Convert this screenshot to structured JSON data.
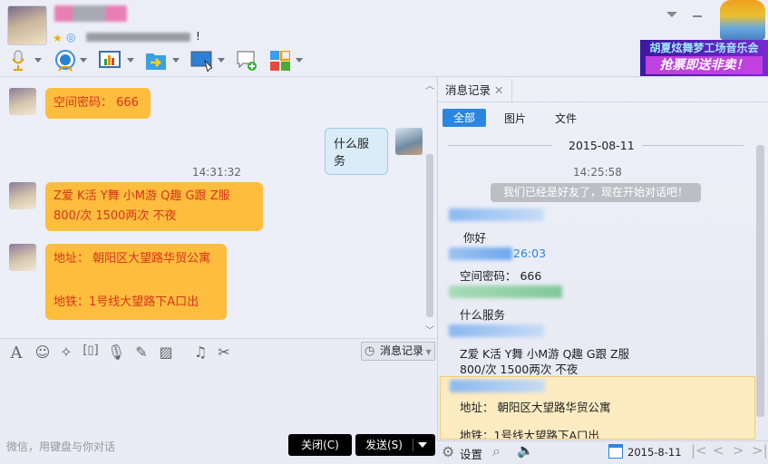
{
  "header": {
    "status_suffix": "!",
    "banner": {
      "line1": "胡夏炫舞梦工场音乐会",
      "line2": "抢票即送非卖！"
    }
  },
  "toolbar": {
    "icons": [
      "microphone-icon",
      "webcam-icon",
      "screen-share-icon",
      "file-transfer-icon",
      "remote-desktop-icon",
      "new-chat-icon",
      "apps-icon"
    ]
  },
  "chat": {
    "messages": [
      {
        "side": "left",
        "text": "空间密码： 666"
      },
      {
        "side": "right",
        "text": "什么服务"
      },
      {
        "timestamp": "14:31:32"
      },
      {
        "side": "left",
        "lines": [
          "Z爱  K活  Y舞  小M游  Q趣  G跟  Z服",
          "800/次   1500两次     不夜"
        ]
      },
      {
        "side": "left",
        "lines": [
          "地址：  朝阳区大望路华贸公寓",
          "",
          "地铁：1号线大望路下A口出"
        ]
      }
    ]
  },
  "input": {
    "history_button": "消息记录",
    "placeholder": "微信，用键盘与你对话",
    "close_button": "关闭(C)",
    "send_button": "发送(S)"
  },
  "history": {
    "tab_label": "消息记录",
    "filters": [
      "全部",
      "图片",
      "文件"
    ],
    "date": "2015-08-11",
    "time": "14:25:58",
    "system_notice": "我们已经是好友了，现在开始对话吧！",
    "entries": [
      {
        "text": "你好"
      },
      {
        "time_fragment": "26:03",
        "text": "空间密码： 666"
      },
      {
        "text": "什么服务"
      },
      {
        "lines": [
          "Z爱   K活   Y舞   小M游   Q趣   G跟   Z服",
          "800/次   1500两次     不夜"
        ]
      },
      {
        "lines": [
          "地址：  朝阳区大望路华贸公寓",
          "",
          "地铁：1号线大望路下A口出"
        ]
      }
    ],
    "footer": {
      "settings": "设置",
      "date": "2015-8-11"
    }
  },
  "colors": {
    "bubble": "#ffbd3e",
    "accent": "#2b86e0"
  }
}
